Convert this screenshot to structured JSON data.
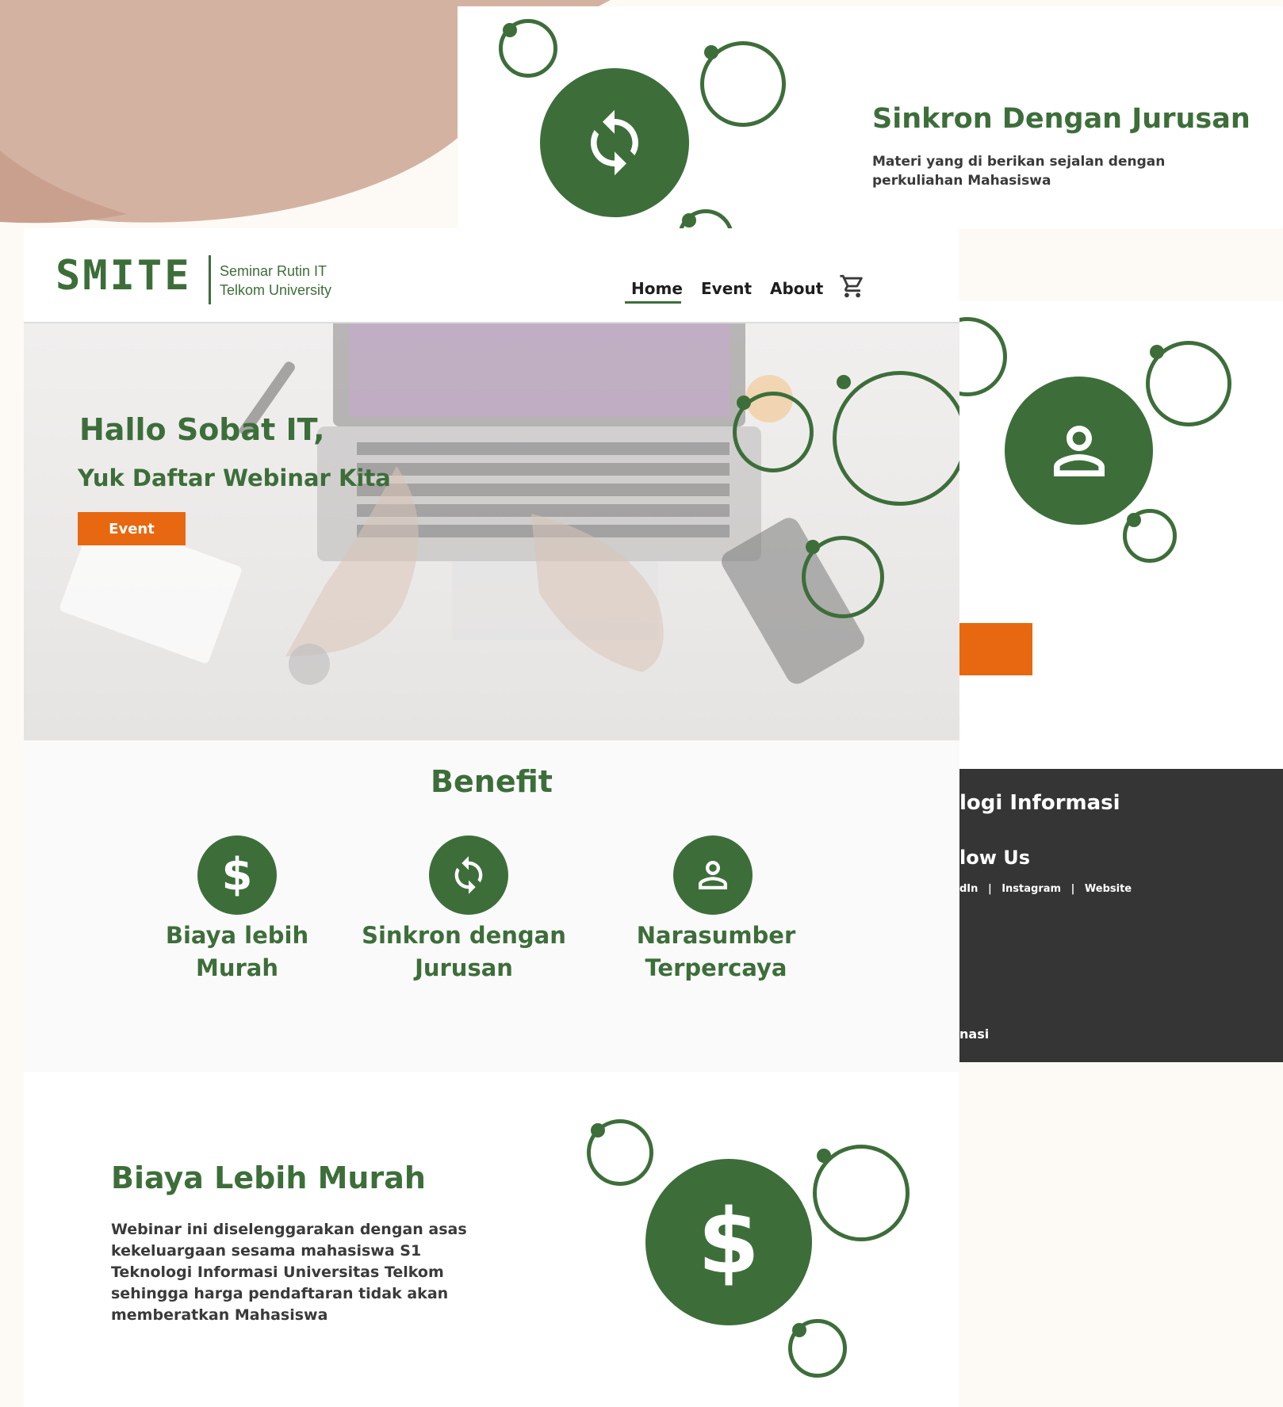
{
  "back_top": {
    "title": "Sinkron Dengan Jurusan",
    "desc": "Materi yang di berikan sejalan dengan perkuliahan Mahasiswa"
  },
  "footer": {
    "heading_partial": "logi Informasi",
    "follow_partial": "low Us",
    "links": [
      "dIn",
      "Instagram",
      "Website"
    ],
    "separator": "|",
    "bottom_partial": "nasi"
  },
  "header": {
    "logo_text": "SMITE",
    "tagline_1": "Seminar Rutin IT",
    "tagline_2": "Telkom University",
    "nav": [
      {
        "label": "Home",
        "active": true
      },
      {
        "label": "Event",
        "active": false
      },
      {
        "label": "About",
        "active": false
      }
    ],
    "cart_icon": "cart-icon"
  },
  "hero": {
    "title": "Hallo Sobat IT,",
    "subtitle": "Yuk Daftar Webinar Kita",
    "cta_label": "Event"
  },
  "benefit": {
    "heading": "Benefit",
    "items": [
      {
        "icon": "dollar-icon",
        "label_1": "Biaya lebih",
        "label_2": "Murah"
      },
      {
        "icon": "sync-icon",
        "label_1": "Sinkron dengan",
        "label_2": "Jurusan"
      },
      {
        "icon": "user-icon",
        "label_1": "Narasumber",
        "label_2": "Terpercaya"
      }
    ]
  },
  "detail": {
    "title": "Biaya Lebih Murah",
    "desc": "Webinar ini diselenggarakan dengan asas kekeluargaan sesama mahasiswa S1 Teknologi Informasi Universitas Telkom sehingga harga pendaftaran tidak akan memberatkan Mahasiswa"
  },
  "colors": {
    "green": "#3d6e3a",
    "orange": "#e76810",
    "dark": "#353535",
    "blob": "#d4b2a1"
  }
}
